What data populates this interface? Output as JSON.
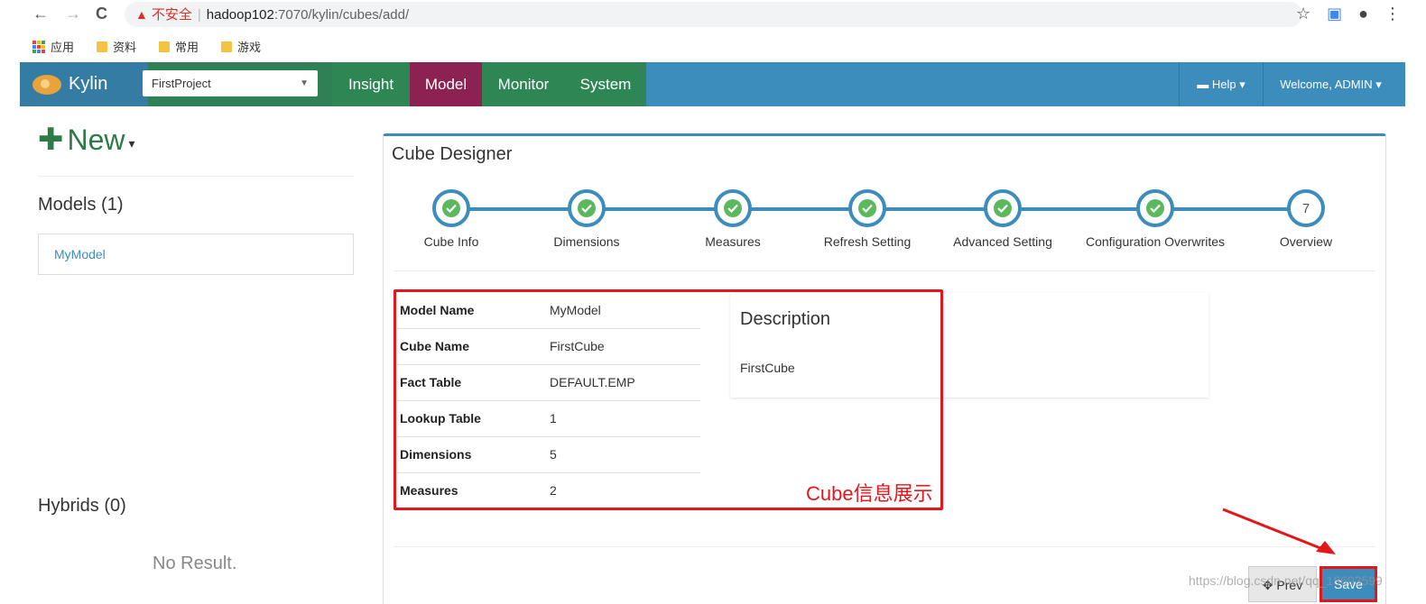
{
  "browser": {
    "back": "←",
    "forward": "→",
    "reload": "C",
    "insecure_label": "不安全",
    "url_host": "hadoop102",
    "url_path": ":7070/kylin/cubes/add/",
    "bookmarks": [
      {
        "label": "应用"
      },
      {
        "label": "资料"
      },
      {
        "label": "常用"
      },
      {
        "label": "游戏"
      }
    ]
  },
  "navbar": {
    "brand": "Kylin",
    "project": "FirstProject",
    "tabs": [
      {
        "label": "Insight",
        "active": false
      },
      {
        "label": "Model",
        "active": true
      },
      {
        "label": "Monitor",
        "active": false
      },
      {
        "label": "System",
        "active": false
      }
    ],
    "help": "Help",
    "welcome": "Welcome, ADMIN"
  },
  "sidebar": {
    "new_label": "New",
    "models_title": "Models (1)",
    "models": [
      "MyModel"
    ],
    "hybrids_title": "Hybrids (0)",
    "no_result": "No Result."
  },
  "designer": {
    "title": "Cube Designer",
    "steps": [
      {
        "label": "Cube Info",
        "done": true
      },
      {
        "label": "Dimensions",
        "done": true
      },
      {
        "label": "Measures",
        "done": true
      },
      {
        "label": "Refresh Setting",
        "done": true
      },
      {
        "label": "Advanced Setting",
        "done": true
      },
      {
        "label": "Configuration Overwrites",
        "done": true
      },
      {
        "label": "Overview",
        "done": false,
        "number": "7"
      }
    ],
    "info": [
      {
        "key": "Model Name",
        "value": "MyModel"
      },
      {
        "key": "Cube Name",
        "value": "FirstCube"
      },
      {
        "key": "Fact Table",
        "value": "DEFAULT.EMP"
      },
      {
        "key": "Lookup Table",
        "value": "1"
      },
      {
        "key": "Dimensions",
        "value": "5"
      },
      {
        "key": "Measures",
        "value": "2"
      }
    ],
    "description_title": "Description",
    "description": "FirstCube",
    "annotation": "Cube信息展示",
    "prev_label": "Prev",
    "save_label": "Save"
  },
  "watermark": "https://blog.csdn.net/qq_18603599",
  "colors": {
    "navbar": "#3c8dbc",
    "active_tab": "#8b2252",
    "tab": "#2e8654",
    "check": "#5cb85c",
    "annotation": "#e4161b"
  }
}
